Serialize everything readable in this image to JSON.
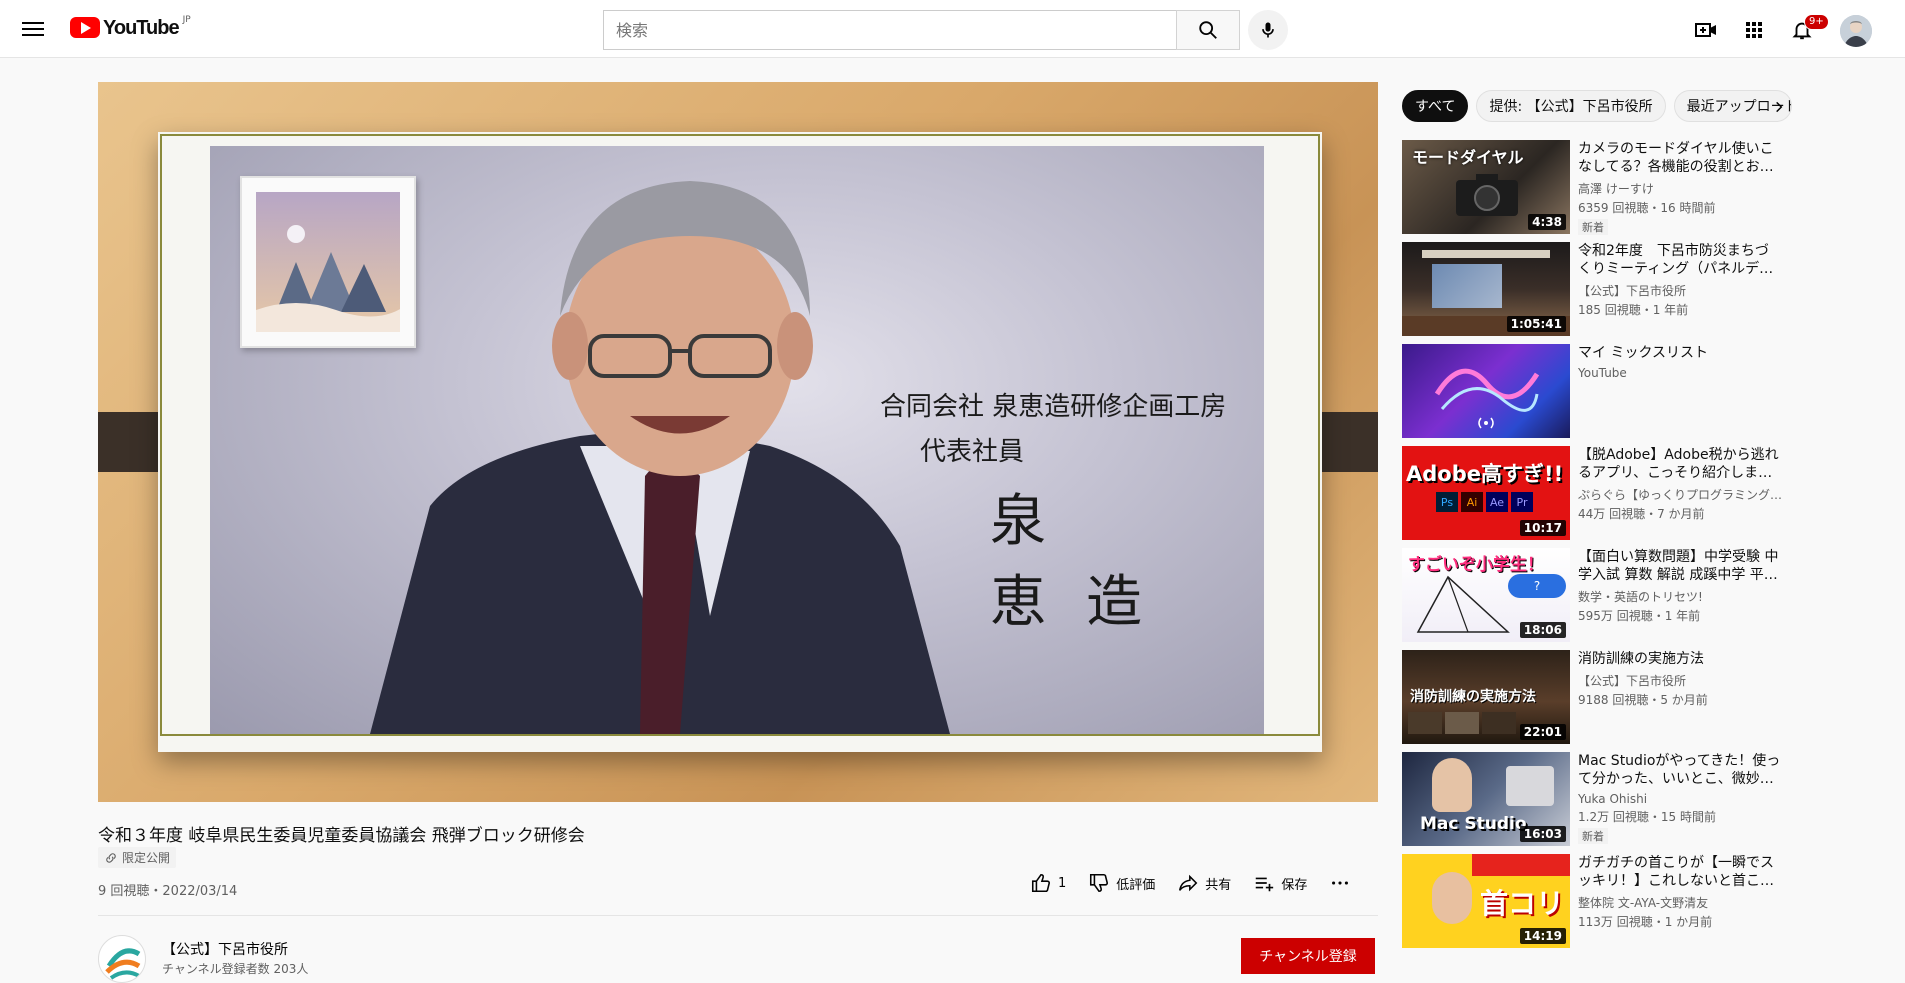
{
  "header": {
    "logo_text": "YouTube",
    "region": "JP",
    "search_placeholder": "検索",
    "notification_count": "9+"
  },
  "video": {
    "title": "令和３年度 岐阜県民生委員児童委員協議会 飛弾ブロック研修会",
    "privacy": "限定公開",
    "views_date": "9 回視聴・2022/03/14",
    "captions": [
      "合同会社 泉恵造研修企画工房",
      "代表社員",
      "泉　恵造"
    ]
  },
  "actions": {
    "like_count": "1",
    "dislike": "低評価",
    "share": "共有",
    "save": "保存"
  },
  "channel": {
    "name": "【公式】下呂市役所",
    "subs": "チャンネル登録者数 203人",
    "subscribe": "チャンネル登録"
  },
  "chips": [
    "すべて",
    "提供: 【公式】下呂市役所",
    "最近アップロードされた動画"
  ],
  "recommendations": [
    {
      "title": "カメラのモードダイヤル使いこなしてる？各機能の役割とお…",
      "channel": "高澤 けーすけ",
      "meta": "6359 回視聴・16 時間前",
      "badge": "新着",
      "duration": "4:38",
      "thumb_text": "モードダイヤル"
    },
    {
      "title": "令和2年度　下呂市防災まちづくりミーティング（パネルデ…",
      "channel": "【公式】下呂市役所",
      "meta": "185 回視聴・1 年前",
      "badge": "",
      "duration": "1:05:41",
      "thumb_text": ""
    },
    {
      "title": "マイ ミックスリスト",
      "channel": "YouTube",
      "meta": "",
      "badge": "",
      "duration": "",
      "thumb_text": ""
    },
    {
      "title": "【脱Adobe】Adobe税から逃れるアプリ、こっそり紹介しま…",
      "channel": "ぷらぐら【ゆっくりプログラミング…",
      "meta": "44万 回視聴・7 か月前",
      "badge": "",
      "duration": "10:17",
      "thumb_text": "Adobe高すぎ!!"
    },
    {
      "title": "【面白い算数問題】中学受験 中学入試 算数 解説 成蹊中学 平…",
      "channel": "数学・英語のトリセツ!",
      "meta": "595万 回視聴・1 年前",
      "badge": "",
      "duration": "18:06",
      "thumb_text": "すごいぞ小学生！"
    },
    {
      "title": "消防訓練の実施方法",
      "channel": "【公式】下呂市役所",
      "meta": "9188 回視聴・5 か月前",
      "badge": "",
      "duration": "22:01",
      "thumb_text": "消防訓練の実施方法"
    },
    {
      "title": "Mac Studioがやってきた！使って分かった、いいとこ、微妙…",
      "channel": "Yuka Ohishi",
      "meta": "1.2万 回視聴・15 時間前",
      "badge": "新着",
      "duration": "16:03",
      "thumb_text": "Mac Studio"
    },
    {
      "title": "ガチガチの首こりが【一瞬でスッキリ！】これしないと首こ…",
      "channel": "整体院 文-AYA-文野清友",
      "meta": "113万 回視聴・1 か月前",
      "badge": "",
      "duration": "14:19",
      "thumb_text": "首コリ"
    }
  ],
  "colors": {
    "accent": "#ff0000",
    "subscribe": "#cc0000"
  }
}
